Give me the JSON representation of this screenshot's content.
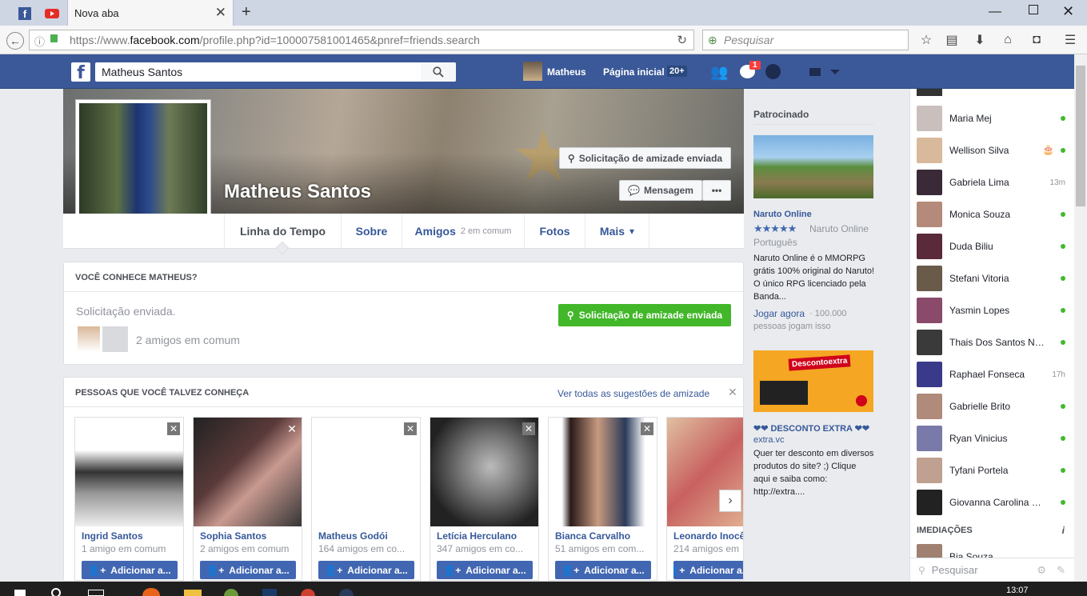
{
  "browser": {
    "tab_title": "Nova aba",
    "url_prefix": "https://www.",
    "url_domain": "facebook.com",
    "url_path": "/profile.php?id=100007581001465&pnref=friends.search",
    "search_placeholder": "Pesquisar"
  },
  "fb_nav": {
    "search_value": "Matheus Santos",
    "user_name": "Matheus",
    "home_label": "Página inicial",
    "home_count": "20+",
    "messages_badge": "1"
  },
  "profile": {
    "name": "Matheus Santos",
    "friend_request_sent": "Solicitação de amizade enviada",
    "message_label": "Mensagem",
    "more_label": "•••",
    "tabs": [
      {
        "label": "Linha do Tempo",
        "extra": ""
      },
      {
        "label": "Sobre",
        "extra": ""
      },
      {
        "label": "Amigos",
        "extra": "2 em comum"
      },
      {
        "label": "Fotos",
        "extra": ""
      },
      {
        "label": "Mais",
        "extra": "▾"
      }
    ]
  },
  "know_card": {
    "title": "Você conhece Matheus?",
    "status": "Solicitação enviada.",
    "button": "Solicitação de amizade enviada",
    "mutual": "2 amigos em comum"
  },
  "pymk": {
    "title": "Pessoas que você talvez conheça",
    "see_all": "Ver todas as sugestões de amizade",
    "add_label": "Adicionar a...",
    "people": [
      {
        "name": "Ingrid Santos",
        "mutual": "1 amigo em comum",
        "color": "#9a9a9a"
      },
      {
        "name": "Sophia Santos",
        "mutual": "2 amigos em comum",
        "color": "#6e4b4a"
      },
      {
        "name": "Matheus Godói",
        "mutual": "164 amigos em co...",
        "color": "#ffffff"
      },
      {
        "name": "Letícia Herculano",
        "mutual": "347 amigos em co...",
        "color": "#555555"
      },
      {
        "name": "Bianca Carvalho",
        "mutual": "51 amigos em com...",
        "color": "#2a3a58"
      },
      {
        "name": "Leonardo Inocê",
        "mutual": "214 amigos em",
        "color": "#c8a48a"
      }
    ]
  },
  "sponsored": {
    "title": "Patrocinado",
    "ad1": {
      "name": "Naruto Online",
      "rating_text": "Naruto Online",
      "lang": "Português",
      "body": "Naruto Online é o MMORPG grátis 100% original do Naruto! O único RPG licenciado pela Banda...",
      "cta": "Jogar agora",
      "cta_meta": "· 100.000",
      "meta2": "pessoas jogam isso"
    },
    "ad2": {
      "banner_text": "Descontoextra",
      "name": "❤❤ DESCONTO EXTRA ❤❤",
      "domain": "extra.vc",
      "body": "Quer ter desconto em diversos produtos do site? ;) Clique aqui e saiba como: http://extra...."
    }
  },
  "chat": {
    "contacts": [
      {
        "name": "Maria Mej",
        "status": "online",
        "time": "",
        "color": "#c9c0bd"
      },
      {
        "name": "Wellison Silva",
        "status": "online",
        "time": "",
        "color": "#d9b99b"
      },
      {
        "name": "Gabriela Lima",
        "status": "away",
        "time": "13m",
        "color": "#3a2a38"
      },
      {
        "name": "Monica Souza",
        "status": "online",
        "time": "",
        "color": "#b48a7a"
      },
      {
        "name": "Duda Biliu",
        "status": "online",
        "time": "",
        "color": "#5a2a3a"
      },
      {
        "name": "Stefani Vitoria",
        "status": "online",
        "time": "",
        "color": "#6a5a4a"
      },
      {
        "name": "Yasmin Lopes",
        "status": "online",
        "time": "",
        "color": "#8a4a6a"
      },
      {
        "name": "Thais Dos Santos Na...",
        "status": "online",
        "time": "",
        "color": "#3a3a3a"
      },
      {
        "name": "Raphael Fonseca",
        "status": "away",
        "time": "17h",
        "color": "#3a3a8a"
      },
      {
        "name": "Gabrielle Brito",
        "status": "online",
        "time": "",
        "color": "#b08a7a"
      },
      {
        "name": "Ryan Vinicius",
        "status": "online",
        "time": "",
        "color": "#7a7aaa"
      },
      {
        "name": "Tyfani Portela",
        "status": "online",
        "time": "",
        "color": "#c0a090"
      },
      {
        "name": "Giovanna Carolina D...",
        "status": "online",
        "time": "",
        "color": "#222222"
      }
    ],
    "section_title": "IMEDIAÇÕES",
    "nearby": "Bia Souza",
    "search_placeholder": "Pesquisar"
  },
  "taskbar": {
    "time": "13:07"
  },
  "colors": {
    "fb_blue": "#3b5998",
    "green": "#42b72a",
    "link": "#365899"
  }
}
